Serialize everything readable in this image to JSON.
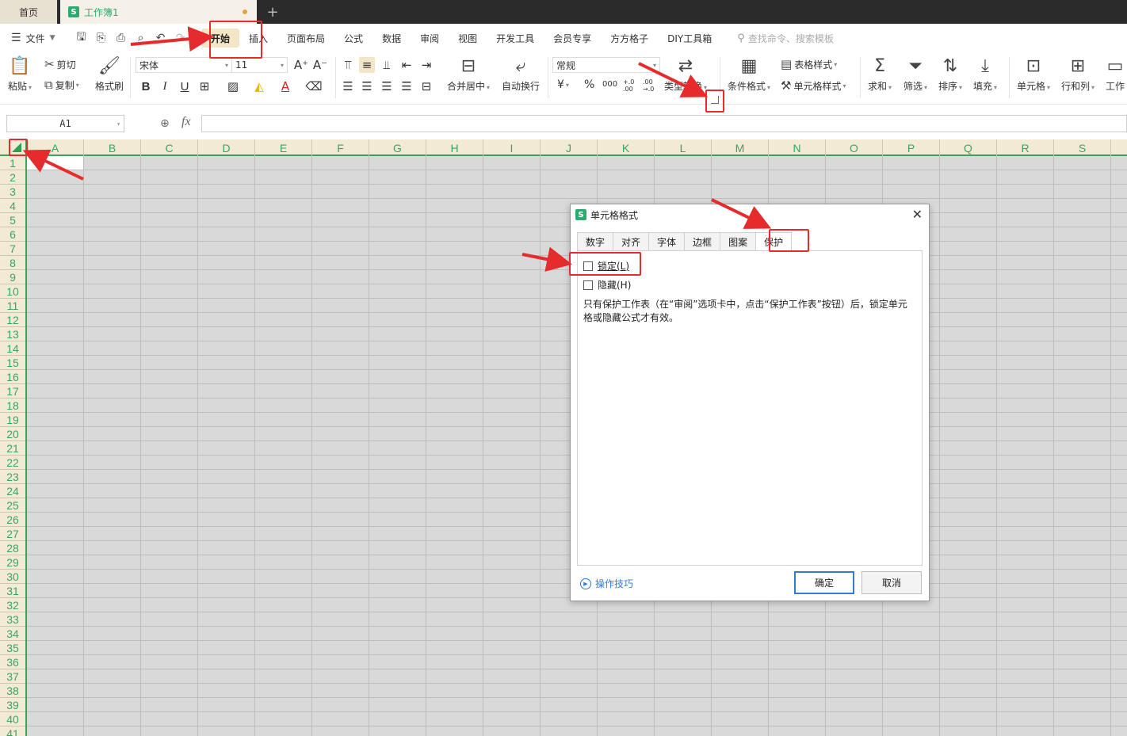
{
  "tabbar": {
    "home_label": "首页",
    "doc_name": "工作簿1",
    "app_badge": "S",
    "new_tab": "+"
  },
  "menubar": {
    "file_label": "文件",
    "items": [
      "开始",
      "插入",
      "页面布局",
      "公式",
      "数据",
      "审阅",
      "视图",
      "开发工具",
      "会员专享",
      "方方格子",
      "DIY工具箱"
    ],
    "active_index": 0,
    "search_placeholder": "查找命令、搜索模板"
  },
  "ribbon": {
    "clipboard": {
      "paste": "粘贴",
      "cut": "剪切",
      "copy": "复制",
      "format_painter": "格式刷"
    },
    "font": {
      "name": "宋体",
      "size": "11",
      "bold": "B",
      "italic": "I",
      "underline": "U",
      "font_color_glyph": "A",
      "grow": "A⁺",
      "shrink": "A⁻"
    },
    "alignment": {
      "merge_center": "合并居中",
      "wrap_text": "自动换行"
    },
    "number": {
      "format": "常规",
      "currency": "¥",
      "percent": "%",
      "thousands": "000",
      "inc_decimal": "+.0 .00",
      "dec_decimal": ".00 →.0",
      "type_convert": "类型转换"
    },
    "styles": {
      "conditional_format": "条件格式",
      "table_style": "表格样式",
      "cell_style": "单元格样式"
    },
    "editing": {
      "sum": "求和",
      "filter": "筛选",
      "sort": "排序",
      "fill": "填充",
      "cell": "单元格",
      "row_col": "行和列",
      "worksheet": "工作"
    }
  },
  "formulabar": {
    "name_box": "A1",
    "fx": "fx",
    "formula": ""
  },
  "grid": {
    "columns": [
      "A",
      "B",
      "C",
      "D",
      "E",
      "F",
      "G",
      "H",
      "I",
      "J",
      "K",
      "L",
      "M",
      "N",
      "O",
      "P",
      "Q",
      "R",
      "S"
    ],
    "rows": [
      "1",
      "2",
      "3",
      "4",
      "5",
      "6",
      "7",
      "8",
      "9",
      "10",
      "11",
      "12",
      "13",
      "14",
      "15",
      "16",
      "17",
      "18",
      "19",
      "20",
      "21",
      "22",
      "23",
      "24",
      "25",
      "26",
      "27",
      "28",
      "29",
      "30",
      "31",
      "32",
      "33",
      "34",
      "35",
      "36",
      "37",
      "38",
      "39",
      "40",
      "41"
    ]
  },
  "dialog": {
    "title": "单元格格式",
    "app_badge": "S",
    "close": "✕",
    "tabs": [
      "数字",
      "对齐",
      "字体",
      "边框",
      "图案",
      "保护"
    ],
    "active_tab": 5,
    "locked_label": "锁定(L)",
    "locked_checked": false,
    "hidden_label": "隐藏(H)",
    "hidden_checked": false,
    "note": "只有保护工作表（在“审阅”选项卡中，点击“保护工作表”按钮）后，锁定单元格或隐藏公式才有效。",
    "tips_label": "操作技巧",
    "ok_label": "确定",
    "cancel_label": "取消"
  },
  "colors": {
    "accent_green": "#3aa45f",
    "annotation_red": "#e52b2b",
    "link_blue": "#2f7bd6",
    "active_menu_bg": "#f3e6c6"
  }
}
